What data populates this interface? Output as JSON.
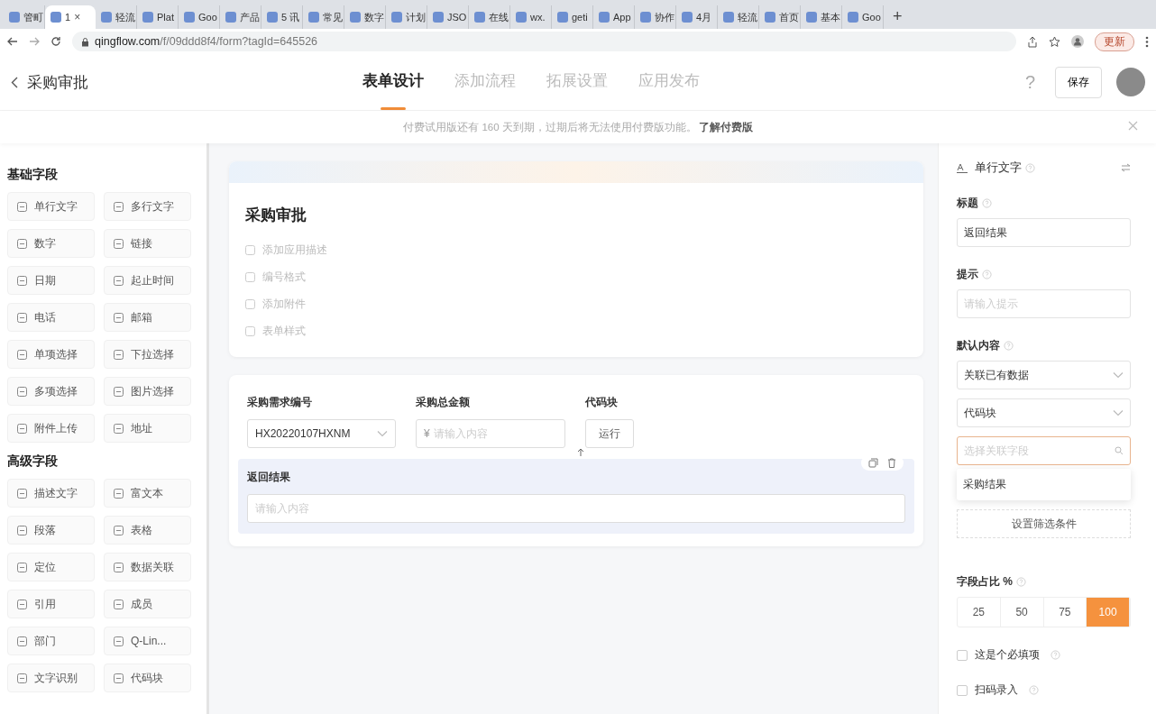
{
  "browser": {
    "tabs": [
      {
        "title": "管町",
        "selected": false
      },
      {
        "title": "1",
        "selected": true
      },
      {
        "title": "轻流",
        "selected": false
      },
      {
        "title": "Plat",
        "selected": false
      },
      {
        "title": "Goo",
        "selected": false
      },
      {
        "title": "产品",
        "selected": false
      },
      {
        "title": "5 讯",
        "selected": false
      },
      {
        "title": "常见",
        "selected": false
      },
      {
        "title": "数字",
        "selected": false
      },
      {
        "title": "计划",
        "selected": false
      },
      {
        "title": "JSO",
        "selected": false
      },
      {
        "title": "在线",
        "selected": false
      },
      {
        "title": "wx.",
        "selected": false
      },
      {
        "title": "geti",
        "selected": false
      },
      {
        "title": "App",
        "selected": false
      },
      {
        "title": "协作",
        "selected": false
      },
      {
        "title": "4月",
        "selected": false
      },
      {
        "title": "轻流",
        "selected": false
      },
      {
        "title": "首页",
        "selected": false
      },
      {
        "title": "基本",
        "selected": false
      },
      {
        "title": "Goo",
        "selected": false
      }
    ],
    "close_tab": "×",
    "new_tab": "+",
    "url_host": "qingflow.com",
    "url_path": "/f/09ddd8f4/form?tagId=645526",
    "update_button": "更新"
  },
  "header": {
    "back_title": "采购审批",
    "tabs": [
      {
        "label": "表单设计",
        "selected": true
      },
      {
        "label": "添加流程",
        "selected": false
      },
      {
        "label": "拓展设置",
        "selected": false
      },
      {
        "label": "应用发布",
        "selected": false
      }
    ],
    "help": "?",
    "save": "保存"
  },
  "banner": {
    "text": "付费试用版还有 160 天到期，过期后将无法使用付费版功能。",
    "link": "了解付费版"
  },
  "palette": {
    "sections": [
      {
        "title": "基础字段",
        "items": [
          "单行文字",
          "多行文字",
          "数字",
          "链接",
          "日期",
          "起止时间",
          "电话",
          "邮箱",
          "单项选择",
          "下拉选择",
          "多项选择",
          "图片选择",
          "附件上传",
          "地址"
        ]
      },
      {
        "title": "高级字段",
        "items": [
          "描述文字",
          "富文本",
          "段落",
          "表格",
          "定位",
          "数据关联",
          "引用",
          "成员",
          "部门",
          "Q-Lin...",
          "文字识别",
          "代码块"
        ]
      }
    ]
  },
  "form": {
    "title": "采购审批",
    "actions": [
      "添加应用描述",
      "编号格式",
      "添加附件",
      "表单样式"
    ],
    "fields": [
      {
        "kind": "select",
        "label": "采购需求编号",
        "value": "HX20220107HXNM"
      },
      {
        "kind": "currency",
        "label": "采购总金额",
        "prefix": "¥",
        "placeholder": "请输入内容"
      },
      {
        "kind": "button",
        "label": "代码块",
        "button": "运行"
      }
    ],
    "selected_field": {
      "label": "返回结果",
      "placeholder": "请输入内容"
    }
  },
  "props": {
    "type_label": "单行文字",
    "title_label": "标题",
    "title_value": "返回结果",
    "hint_label": "提示",
    "hint_placeholder": "请输入提示",
    "default_label": "默认内容",
    "selects": [
      "关联已有数据",
      "代码块"
    ],
    "search_placeholder": "选择关联字段",
    "options": [
      "采购结果"
    ],
    "filter_button": "设置筛选条件",
    "width_label": "字段占比 %",
    "widths": [
      {
        "label": "25",
        "selected": false
      },
      {
        "label": "50",
        "selected": false
      },
      {
        "label": "75",
        "selected": false
      },
      {
        "label": "100",
        "selected": true
      }
    ],
    "checks": [
      {
        "label": "这是个必填项",
        "checked": false
      },
      {
        "label": "扫码录入",
        "checked": false
      }
    ]
  }
}
